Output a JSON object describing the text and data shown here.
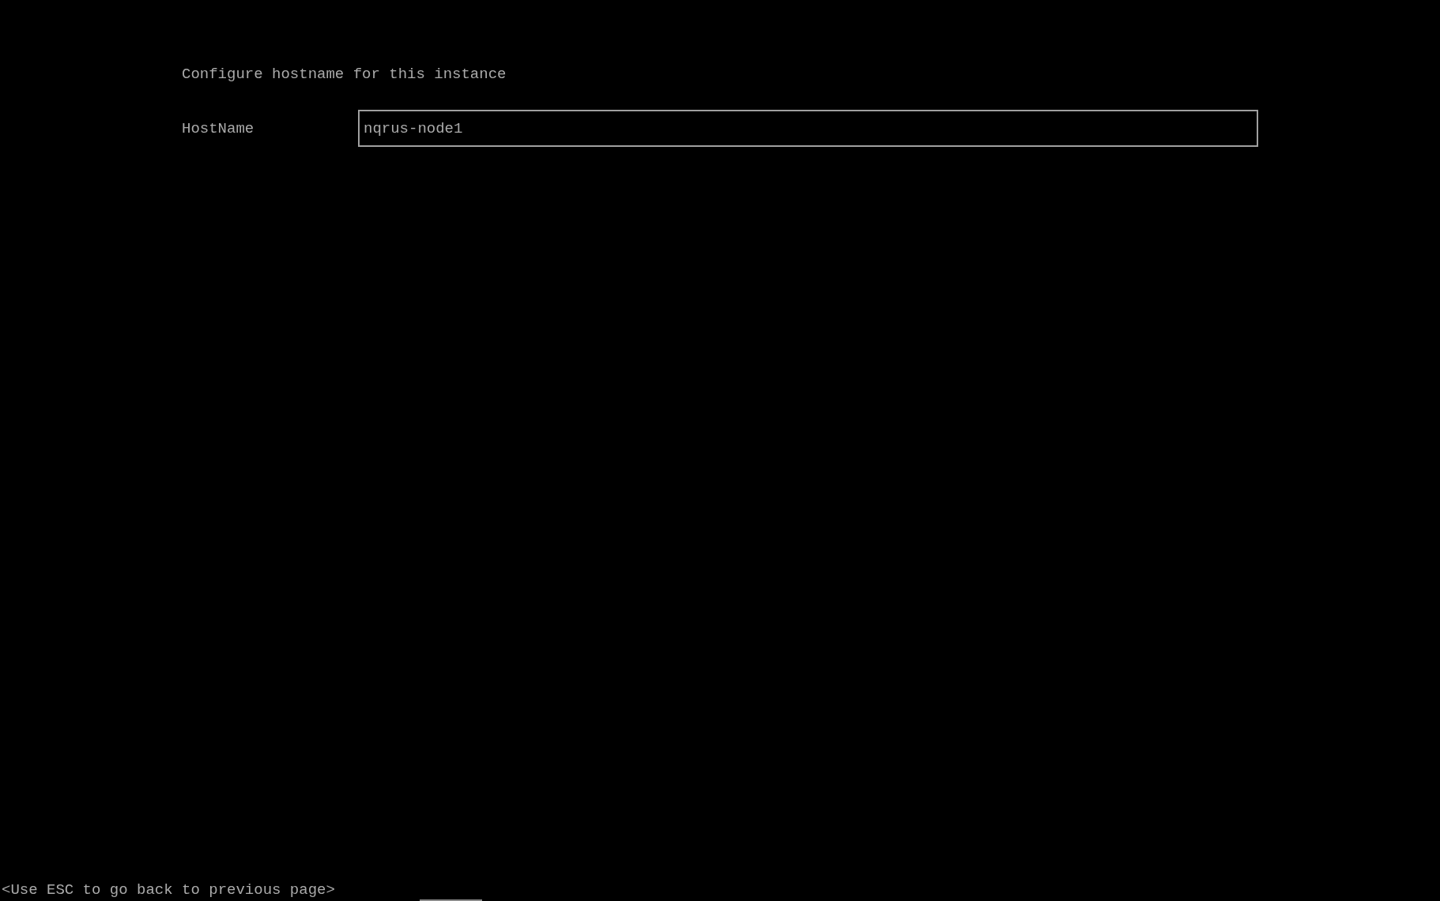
{
  "screen": {
    "heading": "Configure hostname for this instance"
  },
  "form": {
    "fields": [
      {
        "label": "HostName",
        "value": "nqrus-node1"
      }
    ]
  },
  "status_bar": {
    "hint": "<Use ESC to go back to previous page>"
  }
}
